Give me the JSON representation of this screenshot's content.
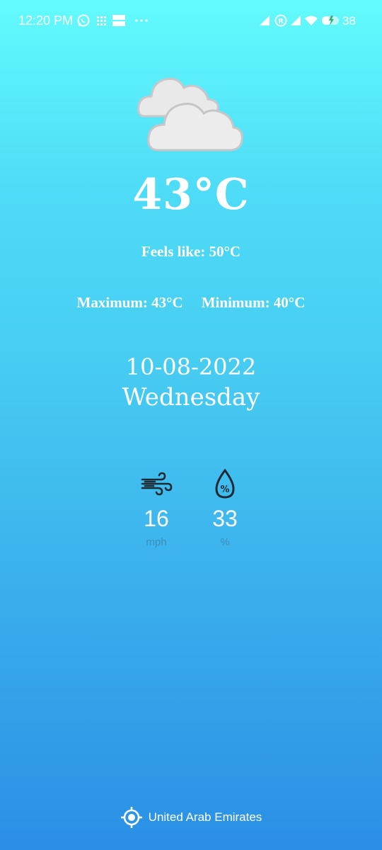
{
  "status_bar": {
    "time": "12:20 PM",
    "battery": "38",
    "icons": [
      "whatsapp-icon",
      "grid-icon",
      "storage-icon",
      "more-dots-icon",
      "signal-icon",
      "registered-icon",
      "signal-icon-2",
      "wifi-icon",
      "battery-icon"
    ]
  },
  "weather": {
    "condition_icon": "cloudy-icon",
    "temperature": "43°C",
    "feels_like": "Feels like: 50°C",
    "maximum": "Maximum: 43°C",
    "minimum": "Minimum: 40°C",
    "date": "10-08-2022",
    "day": "Wednesday"
  },
  "stats": {
    "wind": {
      "icon": "wind-icon",
      "value": "16",
      "unit": "mph"
    },
    "humidity": {
      "icon": "humidity-icon",
      "value": "33",
      "unit": "%"
    }
  },
  "location": {
    "icon": "location-target-icon",
    "name": "United Arab Emirates"
  },
  "colors": {
    "gradient_top": "#62fbfd",
    "gradient_bottom": "#2a8fe5",
    "unit_text": "#3d8fb8"
  }
}
